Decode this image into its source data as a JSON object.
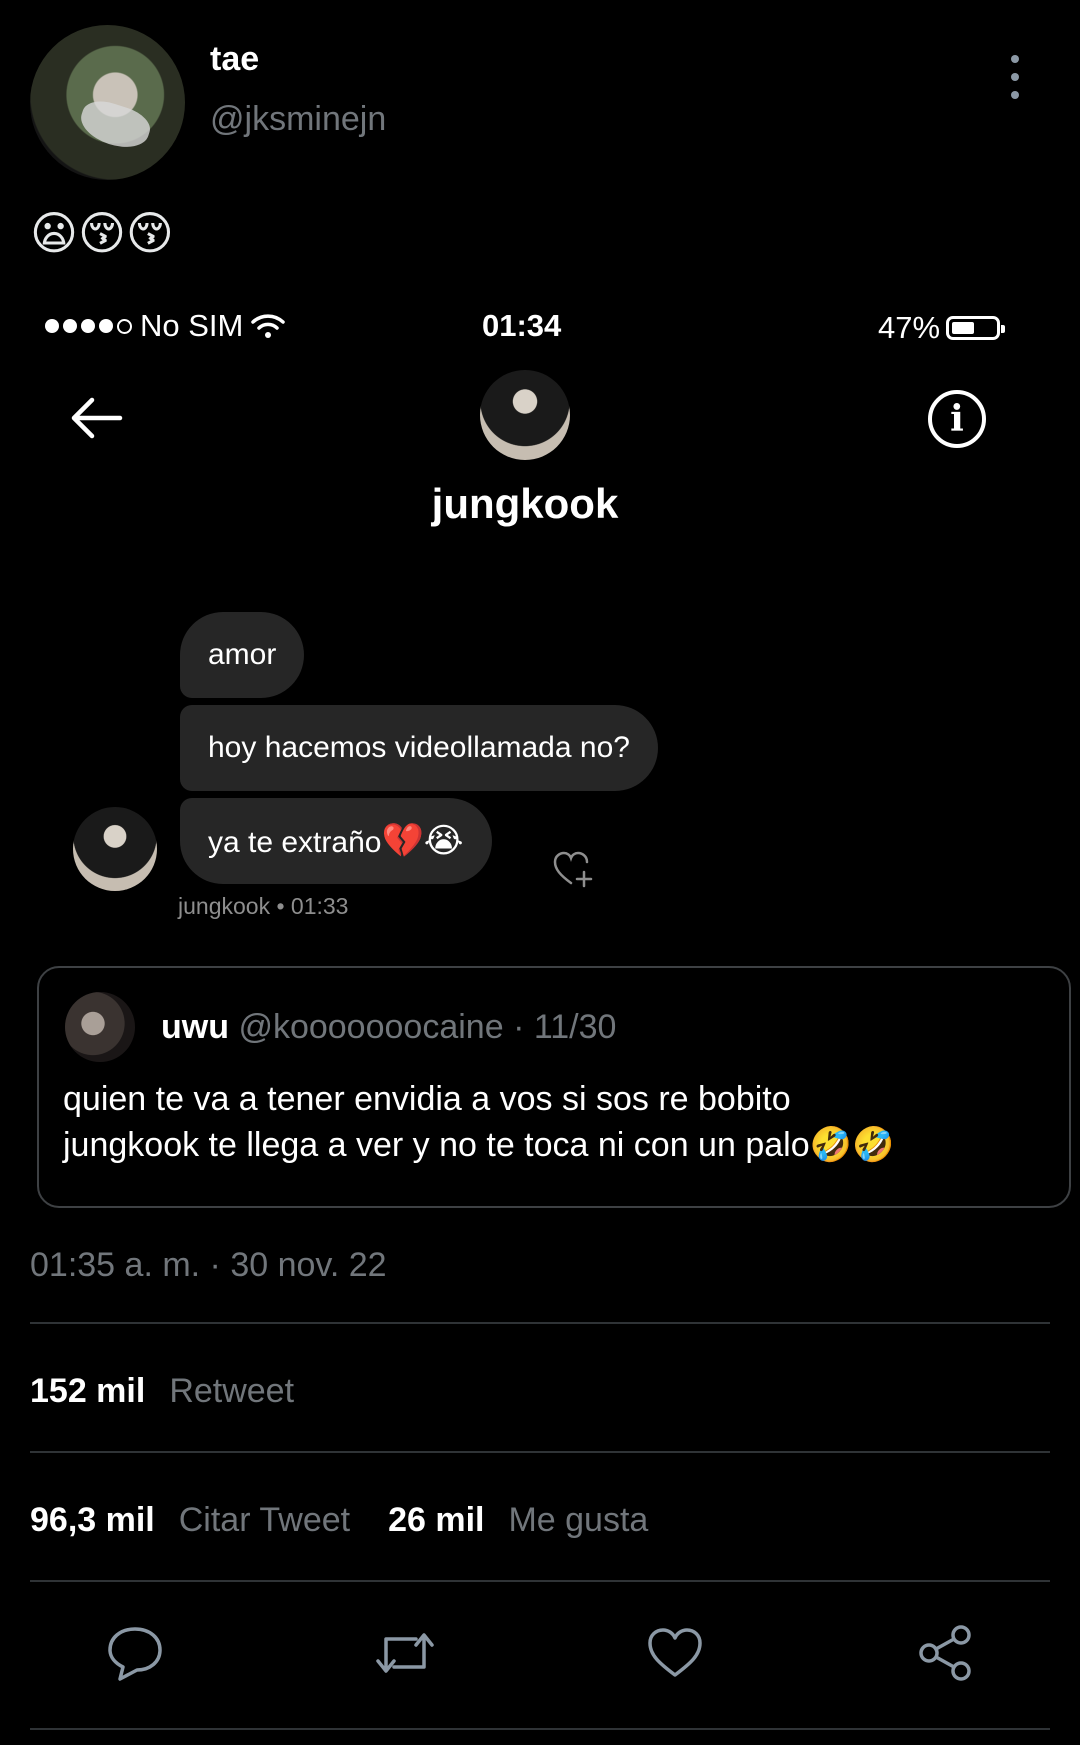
{
  "tweet": {
    "author_name": "tae",
    "author_handle": "@jksminejn",
    "text_emojis": "😦😚😚",
    "timestamp": "01:35 a. m. · 30 nov. 22"
  },
  "embedded_screenshot": {
    "status_bar": {
      "carrier": "No SIM",
      "time": "01:34",
      "battery": "47%"
    },
    "dm_header_name": "jungkook",
    "messages": [
      {
        "text": "amor"
      },
      {
        "text": "hoy hacemos videollamada no?"
      },
      {
        "text": "ya te extraño",
        "emoji": "💔😭"
      }
    ],
    "message_meta": "jungkook • 01:33"
  },
  "quoted_tweet": {
    "name": "uwu",
    "handle": "@kooooooocaine",
    "date": "· 11/30",
    "line1": "quien te va a tener envidia a vos si sos re bobito",
    "line2": "jungkook te llega a ver y no te toca ni con un palo🤣🤣"
  },
  "stats": {
    "retweets_count": "152 mil",
    "retweets_label": "Retweet",
    "quotes_count": "96,3 mil",
    "quotes_label": "Citar Tweet",
    "likes_count": "26 mil",
    "likes_label": "Me gusta"
  },
  "icons": [
    "more-vert-icon",
    "wifi-icon",
    "battery-icon",
    "back-arrow-icon",
    "info-icon",
    "heart-add-icon",
    "reply-icon",
    "retweet-icon",
    "like-icon",
    "share-icon"
  ],
  "colors": {
    "background": "#000000",
    "secondary_text": "#71767b",
    "bubble": "#262626",
    "divider": "#2f3336"
  }
}
